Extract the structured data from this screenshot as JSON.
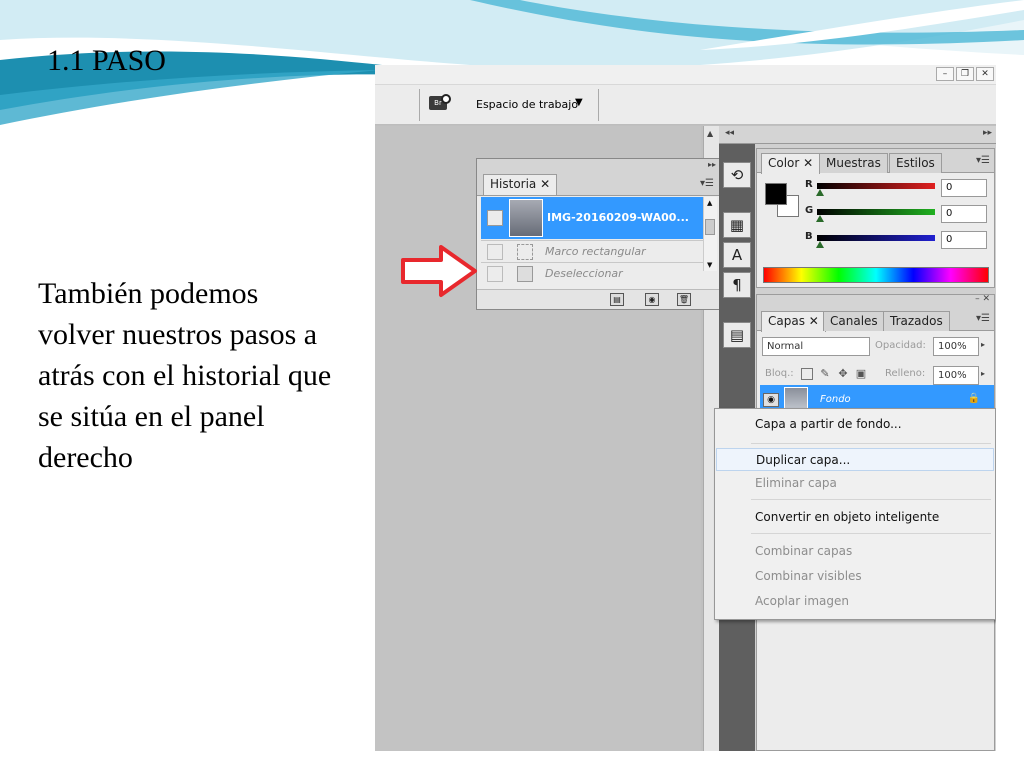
{
  "slide": {
    "title": "1.1 PASO",
    "body": "También podemos volver nuestros pasos a atrás con el historial que se sitúa en el panel derecho"
  },
  "toolbar": {
    "workspace_label": "Espacio de trabajo"
  },
  "history_panel": {
    "tab_label": "Historia",
    "snapshot_name": "IMG-20160209-WA00...",
    "steps": [
      {
        "label": "Marco rectangular"
      },
      {
        "label": "Deseleccionar"
      }
    ]
  },
  "color_panel": {
    "tabs": [
      "Color",
      "Muestras",
      "Estilos"
    ],
    "channels": [
      {
        "name": "R",
        "value": "0",
        "color": "#e02020"
      },
      {
        "name": "G",
        "value": "0",
        "color": "#20b020"
      },
      {
        "name": "B",
        "value": "0",
        "color": "#2020d0"
      }
    ]
  },
  "layers_panel": {
    "tabs": [
      "Capas",
      "Canales",
      "Trazados"
    ],
    "blend_mode": "Normal",
    "opacity_label": "Opacidad:",
    "opacity_value": "100%",
    "lock_label": "Bloq.:",
    "fill_label": "Relleno:",
    "fill_value": "100%",
    "layer_name": "Fondo"
  },
  "context_menu": {
    "items": [
      {
        "label": "Capa a partir de fondo...",
        "enabled": true
      },
      {
        "label": "Duplicar capa...",
        "enabled": true,
        "hover": true
      },
      {
        "label": "Eliminar capa",
        "enabled": false
      },
      {
        "label": "Convertir en objeto inteligente",
        "enabled": true
      },
      {
        "label": "Combinar capas",
        "enabled": false
      },
      {
        "label": "Combinar visibles",
        "enabled": false
      },
      {
        "label": "Acoplar imagen",
        "enabled": false
      }
    ]
  },
  "colors": {
    "selection_blue": "#3399ff",
    "arrow_red": "#e8282d",
    "header_teal": "#1d8fb0"
  },
  "icons": [
    "close-icon",
    "zoom-icon",
    "eye-icon",
    "lock-icon",
    "trash-icon",
    "camera-icon",
    "new-document-icon",
    "character-icon",
    "paragraph-icon",
    "history-icon"
  ]
}
